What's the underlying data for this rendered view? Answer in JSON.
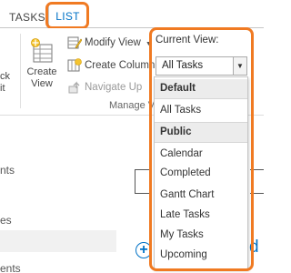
{
  "tabs": [
    {
      "label": "TASKS",
      "active": false
    },
    {
      "label": "LIST",
      "active": true
    }
  ],
  "ribbon": {
    "left_fragment_1": "ck",
    "left_fragment_2": "it",
    "create_view_line1": "Create",
    "create_view_line2": "View",
    "modify_view": "Modify View",
    "create_column": "Create Column",
    "navigate_up": "Navigate Up",
    "group_label": "Manage Vi",
    "current_view_label": "Current View:",
    "current_view_value": "All Tasks"
  },
  "dropdown": {
    "default_header": "Default",
    "default_items": [
      "All Tasks"
    ],
    "public_header": "Public",
    "public_items": [
      "Calendar",
      "Completed",
      "Gantt Chart",
      "Late Tasks",
      "My Tasks",
      "Upcoming"
    ]
  },
  "page": {
    "side_fragment_1": "nts",
    "side_fragment_2": "es",
    "side_fragment_3": "ents",
    "edit_fragment": "d"
  },
  "colors": {
    "accent": "#0072c6",
    "highlight": "#f07a22"
  }
}
